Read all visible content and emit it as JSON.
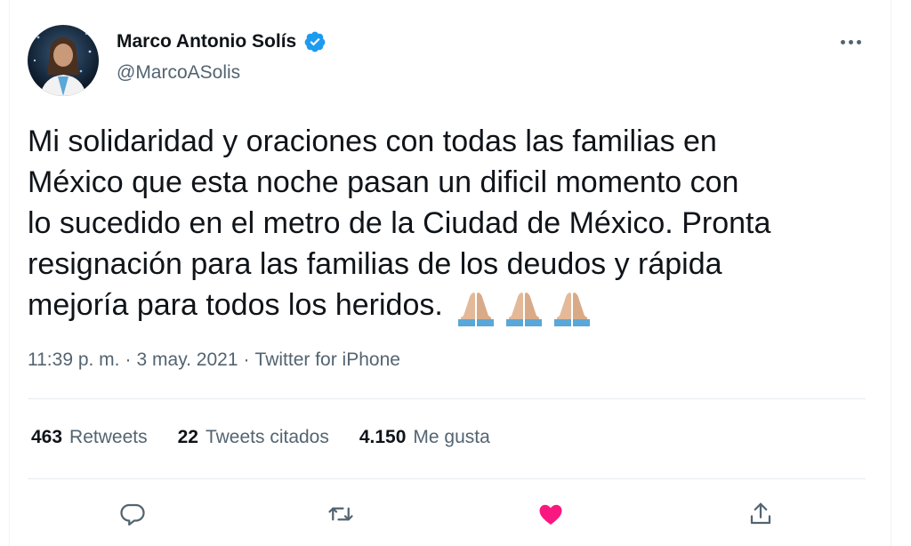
{
  "author": {
    "name": "Marco Antonio Solís",
    "handle": "@MarcoASolis",
    "verified": true
  },
  "tweet": {
    "lines": [
      "Mi solidaridad y oraciones con todas las familias en",
      "México que esta noche pasan un dificil momento con",
      "lo sucedido en el metro de la Ciudad de México. Pronta",
      "resignación para las familias de los deudos y rápida",
      "mejoría para todos los heridos."
    ],
    "emojis": [
      "🙏🏼",
      "🙏🏼",
      "🙏🏼"
    ]
  },
  "meta": {
    "time": "11:39 p. m.",
    "separator": "·",
    "date": "3 may. 2021",
    "source": "Twitter for iPhone"
  },
  "stats": {
    "retweets": {
      "count": "463",
      "label": "Retweets"
    },
    "quotes": {
      "count": "22",
      "label": "Tweets citados"
    },
    "likes": {
      "count": "4.150",
      "label": "Me gusta"
    }
  },
  "actions": {
    "reply": "reply-icon",
    "retweet": "retweet-icon",
    "like": "heart-icon",
    "share": "share-icon"
  },
  "colors": {
    "accent": "#1d9bf0",
    "like": "#f91880",
    "secondary_text": "#536471"
  }
}
